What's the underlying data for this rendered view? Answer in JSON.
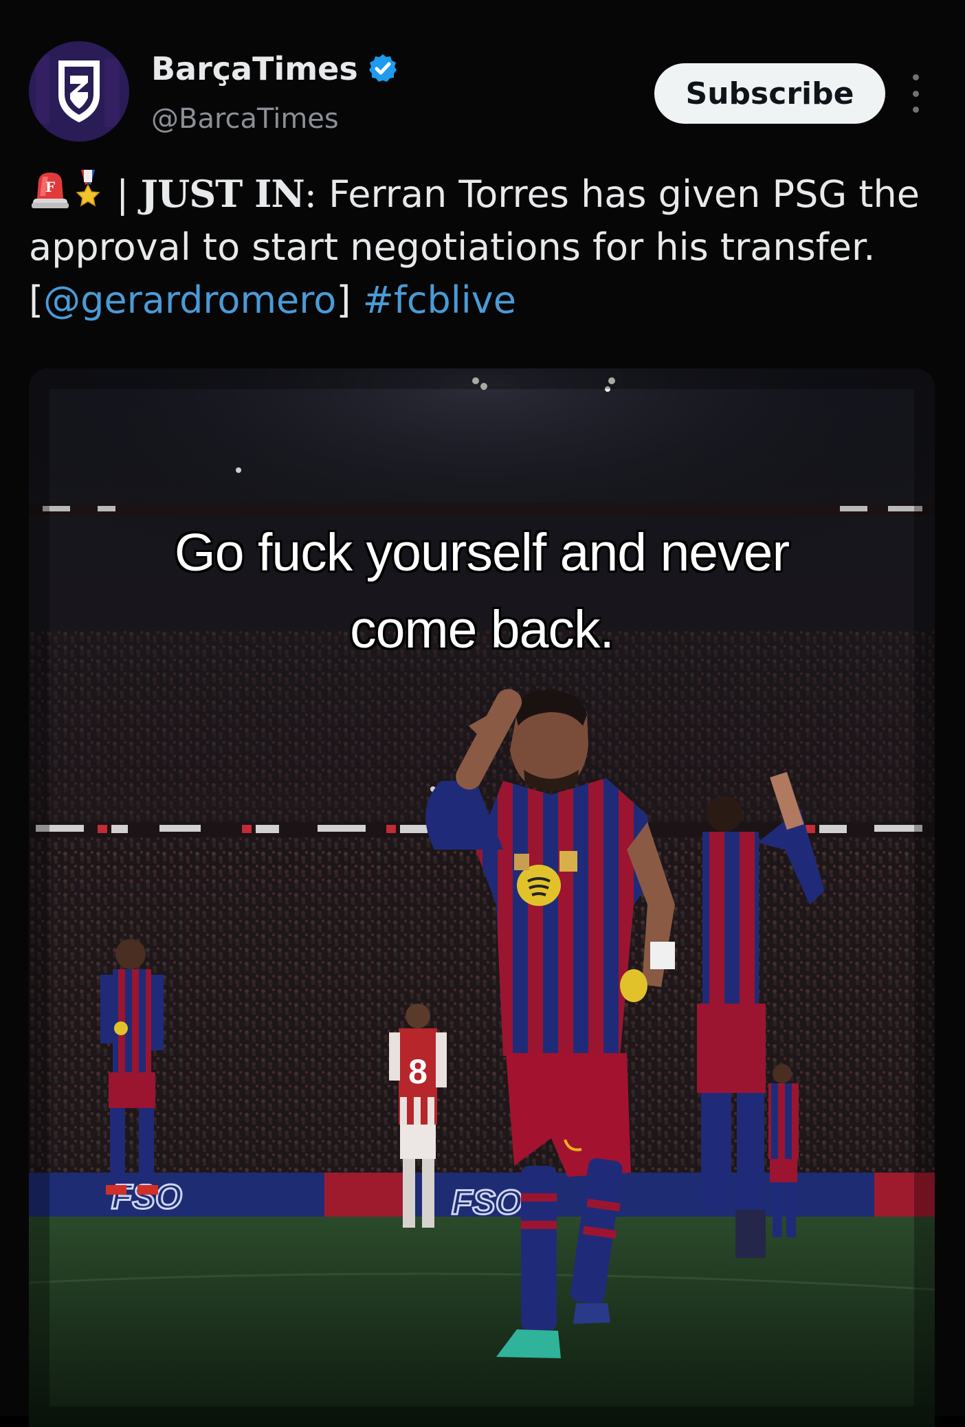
{
  "account": {
    "display_name": "BarçaTimes",
    "handle": "@BarcaTimes",
    "verified": true,
    "avatar_icon": "barca-times-shield-logo"
  },
  "actions": {
    "subscribe_label": "Subscribe",
    "more_icon": "more-vertical-icon"
  },
  "tweet": {
    "emoji_1": "police-light-emoji",
    "emoji_2": "medal-emoji",
    "separator": "|",
    "lead": "JUST IN",
    "lead_colon": ":",
    "body": " Ferran Torres has given PSG the approval to start negotiations for his transfer. ",
    "mention_open": "[",
    "mention": "@gerardromero",
    "mention_close": "] ",
    "hashtag": "#fcblive"
  },
  "media": {
    "caption_line_1": "Go fuck yourself and never",
    "caption_line_2": "come back.",
    "board_text": "FSO",
    "shirt_number": "8"
  },
  "colors": {
    "background": "#060607",
    "link": "#4a9bd6",
    "verified": "#1d9bf0",
    "barca_blue": "#1b2a7a",
    "barca_red": "#a3122e"
  }
}
